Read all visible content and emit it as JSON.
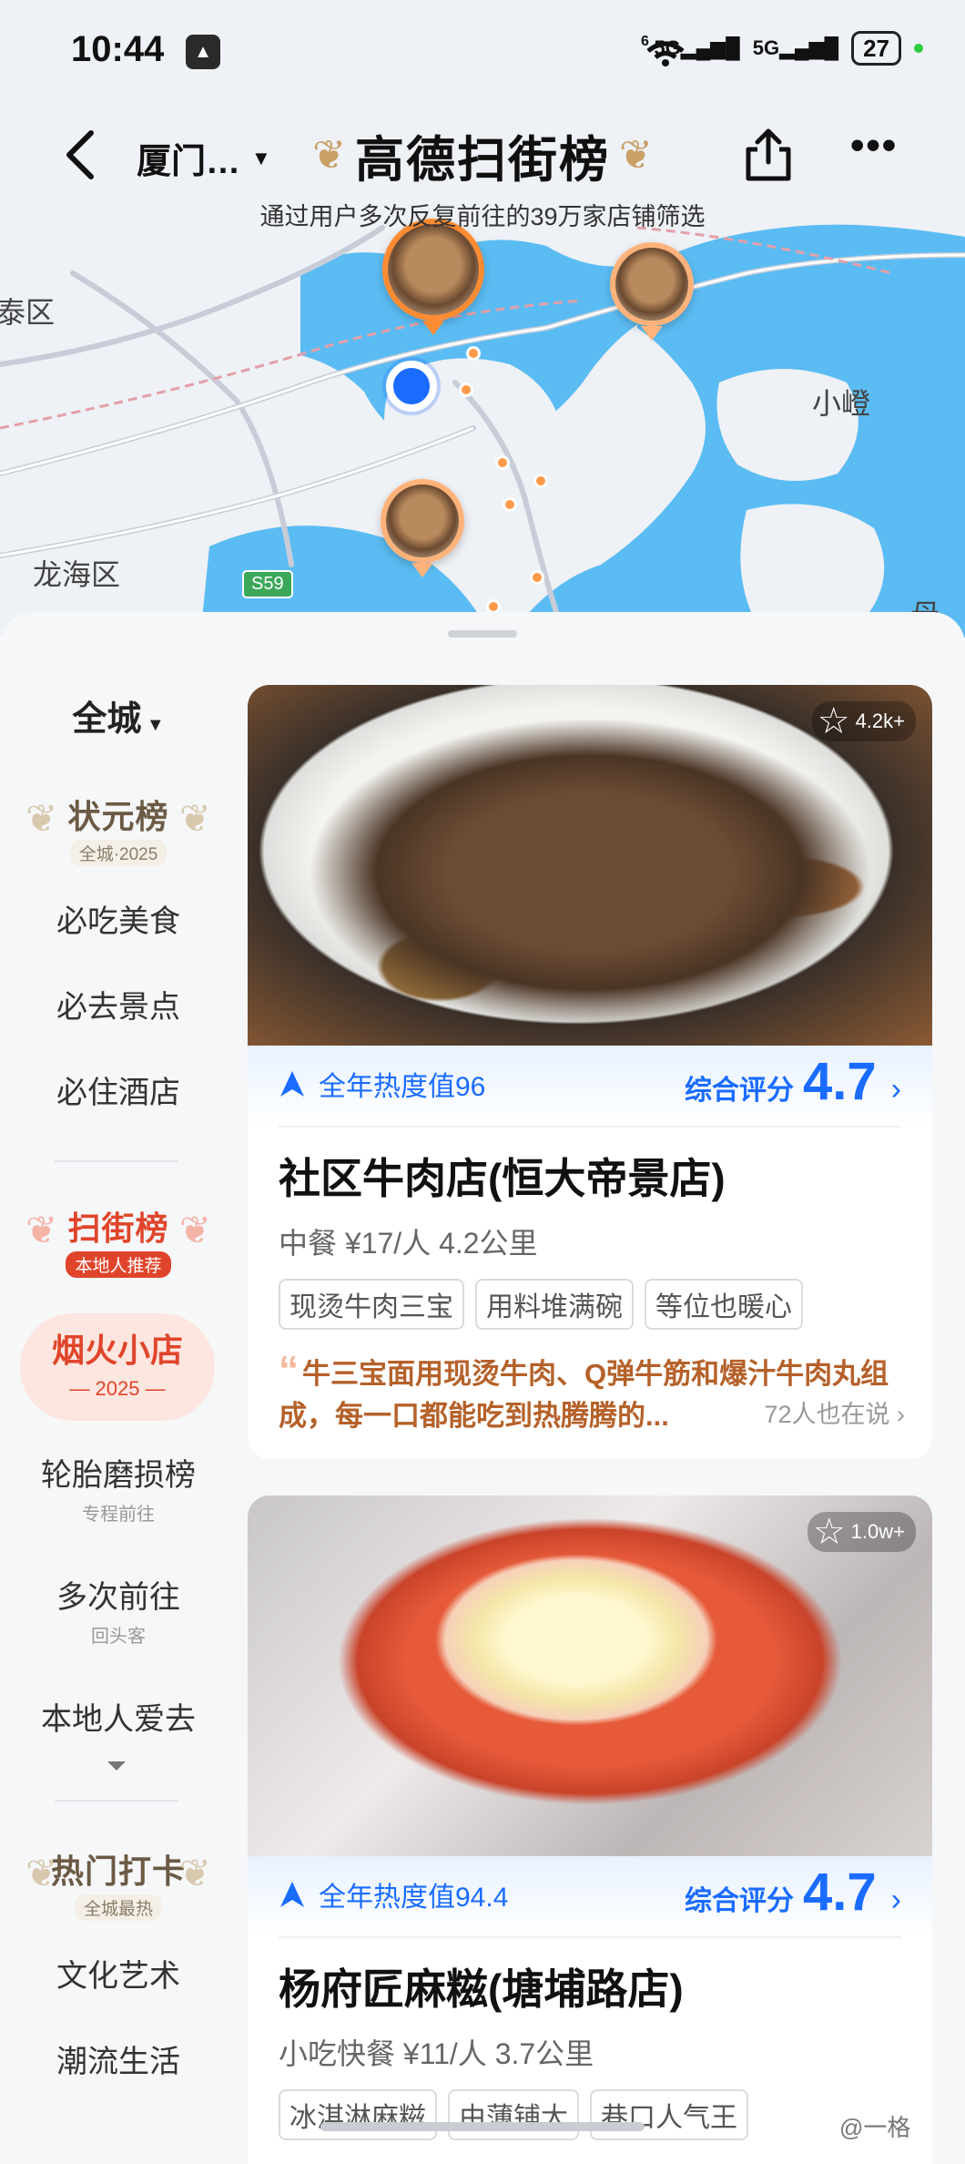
{
  "status": {
    "time": "10:44",
    "network_1": "5G",
    "network_2": "5G",
    "wifi_label": "6",
    "battery": "27"
  },
  "header": {
    "city": "厦门…",
    "brand": "高德扫街榜",
    "subtitle": "通过用户多次反复前往的39万家店铺筛选"
  },
  "map": {
    "labels": [
      "泰区",
      "小嶝",
      "龙海区",
      "母屿"
    ],
    "road_badge": "S59"
  },
  "sidebar": {
    "city_filter": "全城",
    "top_badge": {
      "title": "状元榜",
      "sub": "全城·2025"
    },
    "top_items": [
      "必吃美食",
      "必去景点",
      "必住酒店"
    ],
    "scan_badge": {
      "title": "扫街榜",
      "sub": "本地人推荐"
    },
    "fire": {
      "title": "烟火小店",
      "year": "— 2025 —"
    },
    "items": [
      {
        "label": "轮胎磨损榜",
        "sub": "专程前往"
      },
      {
        "label": "多次前往",
        "sub": "回头客"
      },
      {
        "label": "本地人爱去",
        "sub": ""
      }
    ],
    "hot_badge": {
      "title": "热门打卡",
      "sub": "全城最热"
    },
    "bottom_items": [
      "文化艺术",
      "潮流生活"
    ]
  },
  "cards": [
    {
      "favorites": "4.2k+",
      "heat": "全年热度值96",
      "score_label": "综合评分",
      "score": "4.7",
      "name": "社区牛肉店(恒大帝景店)",
      "meta": "中餐 ¥17/人 4.2公里",
      "tags": [
        "现烫牛肉三宝",
        "用料堆满碗",
        "等位也暖心"
      ],
      "review": "牛三宝面用现烫牛肉、Q弹牛筋和爆汁牛肉丸组成，每一口都能吃到热腾腾的...",
      "review_count": "72人也在说"
    },
    {
      "favorites": "1.0w+",
      "heat": "全年热度值94.4",
      "score_label": "综合评分",
      "score": "4.7",
      "name": "杨府匠麻糍(塘埔路店)",
      "meta": "小吃快餐 ¥11/人 3.7公里",
      "tags": [
        "冰淇淋麻糍",
        "由薄铺大",
        "巷口人气王"
      ]
    }
  ],
  "watermark": "@一格",
  "colors": {
    "accent_blue": "#1a6cff",
    "accent_red": "#e0452c",
    "review_orange": "#b5612a",
    "water": "#5bbcf3"
  }
}
